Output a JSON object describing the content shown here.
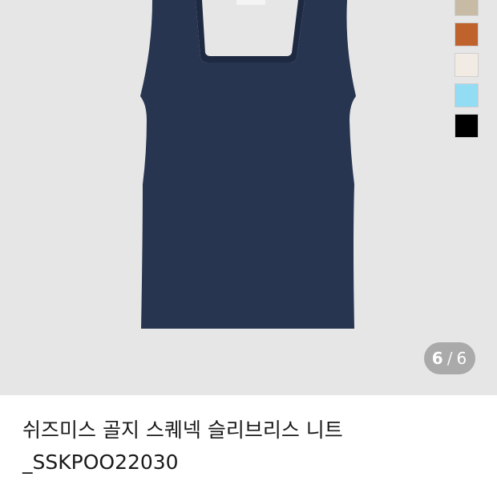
{
  "gallery": {
    "current": "6",
    "separator": "/",
    "total": "6",
    "image": {
      "garment_color": "#283550",
      "background": "#e6e6e6"
    },
    "swatches": [
      {
        "name": "beige-top",
        "color": "#c8bba6"
      },
      {
        "name": "brown",
        "color": "#c0622b"
      },
      {
        "name": "cream",
        "color": "#f1ebe3"
      },
      {
        "name": "sky-blue",
        "color": "#92dcf4"
      },
      {
        "name": "black",
        "color": "#000000"
      }
    ]
  },
  "product": {
    "title_line1": "쉬즈미스 골지 스퀘넥 슬리브리스 니트",
    "title_line2": "_SSKPOO22030"
  }
}
